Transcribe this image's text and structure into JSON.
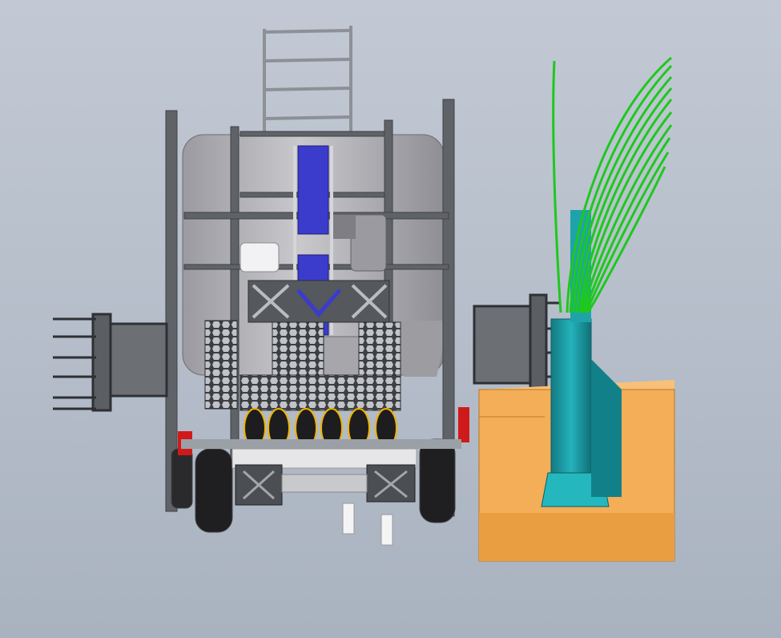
{
  "scene": {
    "subject": "cad-render",
    "colors": {
      "background": "#b3bcc8",
      "frame": "#6f7378",
      "tank": "#b8b8bc",
      "belt": "#3a3ac8",
      "wheel": "#1e1e1e",
      "stem": "#1fa0a8",
      "block": "#f4b25c",
      "leaf": "#1ec81e",
      "accent_red": "#d01a1a",
      "accent_yellow": "#f0b400",
      "accent_green": "#2fb84a"
    },
    "icons": [
      "machine-frame",
      "hopper-tank",
      "conveyor-belt",
      "mecanum-wheel",
      "pruning-gripper",
      "seedling-stem",
      "soil-block",
      "leaf-fronds"
    ]
  }
}
